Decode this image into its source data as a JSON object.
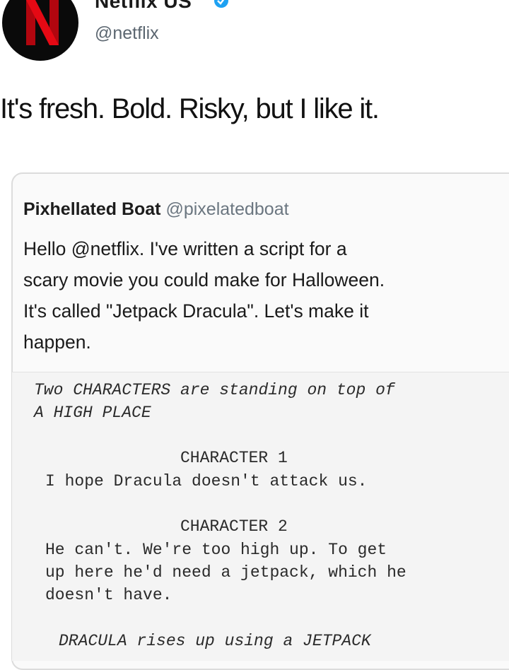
{
  "tweet": {
    "display_name": "Netflix US",
    "handle": "@netflix",
    "text": "It's fresh. Bold. Risky, but I like it."
  },
  "quoted": {
    "name": "Pixhellated Boat",
    "handle": "@pixelatedboat",
    "body_lines": [
      "Hello @netflix. I've written a script for a",
      "scary movie you could make for Halloween.",
      "It's called \"Jetpack Dracula\". Let's make it",
      "happen."
    ]
  },
  "script": {
    "action1": [
      "Two CHARACTERS are standing on top of",
      "A HIGH PLACE"
    ],
    "char1_name": "CHARACTER 1",
    "char1_line": "I hope Dracula doesn't attack us.",
    "char2_name": "CHARACTER 2",
    "char2_lines": [
      "He can't. We're too high up. To get",
      "up here he'd need a jetpack, which he",
      "doesn't have."
    ],
    "action2": "DRACULA rises up using a JETPACK"
  },
  "colors": {
    "brand_red": "#e50914",
    "verified_blue": "#1da1f2"
  }
}
